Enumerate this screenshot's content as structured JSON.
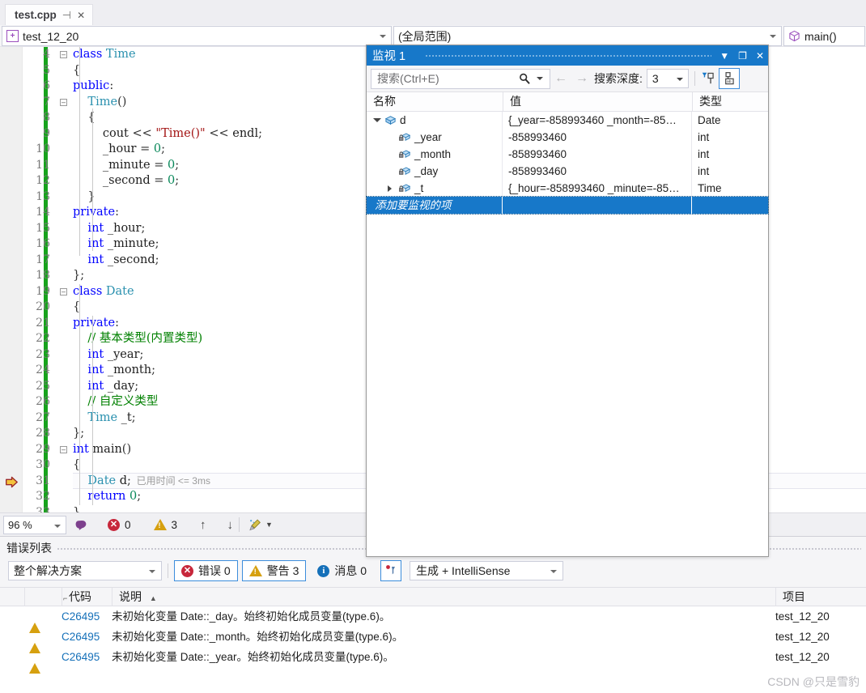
{
  "tabstrip": {
    "document_tab": "test.cpp",
    "pin_icon": "pin-icon",
    "close_icon": "close-icon"
  },
  "navbar": {
    "file_combo": "test_12_20",
    "scope_combo": "(全局范围)",
    "member_combo": "main()"
  },
  "editor": {
    "language": "cpp",
    "lines": [
      {
        "num": "4",
        "indent": 0,
        "fold": "minus",
        "tokens": [
          {
            "t": "class ",
            "c": "kw"
          },
          {
            "t": "Time",
            "c": "typ"
          }
        ]
      },
      {
        "num": "5",
        "indent": 0,
        "tokens": [
          {
            "t": "{",
            "c": "op"
          }
        ]
      },
      {
        "num": "6",
        "indent": 0,
        "tokens": [
          {
            "t": "public",
            "c": "kw"
          },
          {
            "t": ":",
            "c": "op"
          }
        ]
      },
      {
        "num": "7",
        "indent": 1,
        "fold": "minus",
        "tokens": [
          {
            "t": "    Time",
            "c": "typ"
          },
          {
            "t": "()",
            "c": "op"
          }
        ]
      },
      {
        "num": "8",
        "indent": 1,
        "tokens": [
          {
            "t": "    {",
            "c": "op"
          }
        ]
      },
      {
        "num": "9",
        "indent": 2,
        "tokens": [
          {
            "t": "        cout ",
            "c": "plain"
          },
          {
            "t": "<< ",
            "c": "op"
          },
          {
            "t": "\"Time()\"",
            "c": "str"
          },
          {
            "t": " << ",
            "c": "op"
          },
          {
            "t": "endl",
            "c": "plain"
          },
          {
            "t": ";",
            "c": "op"
          }
        ]
      },
      {
        "num": "10",
        "indent": 2,
        "tokens": [
          {
            "t": "        _hour ",
            "c": "plain"
          },
          {
            "t": "= ",
            "c": "op"
          },
          {
            "t": "0",
            "c": "num"
          },
          {
            "t": ";",
            "c": "op"
          }
        ]
      },
      {
        "num": "11",
        "indent": 2,
        "tokens": [
          {
            "t": "        _minute ",
            "c": "plain"
          },
          {
            "t": "= ",
            "c": "op"
          },
          {
            "t": "0",
            "c": "num"
          },
          {
            "t": ";",
            "c": "op"
          }
        ]
      },
      {
        "num": "12",
        "indent": 2,
        "tokens": [
          {
            "t": "        _second ",
            "c": "plain"
          },
          {
            "t": "= ",
            "c": "op"
          },
          {
            "t": "0",
            "c": "num"
          },
          {
            "t": ";",
            "c": "op"
          }
        ]
      },
      {
        "num": "13",
        "indent": 1,
        "tokens": [
          {
            "t": "    }",
            "c": "op"
          }
        ]
      },
      {
        "num": "14",
        "indent": 0,
        "tokens": [
          {
            "t": "private",
            "c": "kw"
          },
          {
            "t": ":",
            "c": "op"
          }
        ]
      },
      {
        "num": "15",
        "indent": 1,
        "tokens": [
          {
            "t": "    int",
            "c": "kw"
          },
          {
            "t": " _hour",
            "c": "plain"
          },
          {
            "t": ";",
            "c": "op"
          }
        ]
      },
      {
        "num": "16",
        "indent": 1,
        "tokens": [
          {
            "t": "    int",
            "c": "kw"
          },
          {
            "t": " _minute",
            "c": "plain"
          },
          {
            "t": ";",
            "c": "op"
          }
        ]
      },
      {
        "num": "17",
        "indent": 1,
        "tokens": [
          {
            "t": "    int",
            "c": "kw"
          },
          {
            "t": " _second",
            "c": "plain"
          },
          {
            "t": ";",
            "c": "op"
          }
        ]
      },
      {
        "num": "18",
        "indent": 0,
        "tokens": [
          {
            "t": "};",
            "c": "op"
          }
        ]
      },
      {
        "num": "19",
        "indent": 0,
        "fold": "minus",
        "tokens": [
          {
            "t": "class ",
            "c": "kw"
          },
          {
            "t": "Date",
            "c": "typ"
          }
        ]
      },
      {
        "num": "20",
        "indent": 0,
        "tokens": [
          {
            "t": "{",
            "c": "op"
          }
        ]
      },
      {
        "num": "21",
        "indent": 0,
        "tokens": [
          {
            "t": "private",
            "c": "kw"
          },
          {
            "t": ":",
            "c": "op"
          }
        ]
      },
      {
        "num": "22",
        "indent": 1,
        "tokens": [
          {
            "t": "    // 基本类型(内置类型)",
            "c": "cmt"
          }
        ]
      },
      {
        "num": "23",
        "indent": 1,
        "tokens": [
          {
            "t": "    int",
            "c": "kw"
          },
          {
            "t": " _year",
            "c": "plain"
          },
          {
            "t": ";",
            "c": "op"
          }
        ]
      },
      {
        "num": "24",
        "indent": 1,
        "tokens": [
          {
            "t": "    int",
            "c": "kw"
          },
          {
            "t": " _month",
            "c": "plain"
          },
          {
            "t": ";",
            "c": "op"
          }
        ]
      },
      {
        "num": "25",
        "indent": 1,
        "tokens": [
          {
            "t": "    int",
            "c": "kw"
          },
          {
            "t": " _day",
            "c": "plain"
          },
          {
            "t": ";",
            "c": "op"
          }
        ]
      },
      {
        "num": "26",
        "indent": 1,
        "tokens": [
          {
            "t": "    // 自定义类型",
            "c": "cmt"
          }
        ]
      },
      {
        "num": "27",
        "indent": 1,
        "tokens": [
          {
            "t": "    Time",
            "c": "typ"
          },
          {
            "t": " _t",
            "c": "plain"
          },
          {
            "t": ";",
            "c": "op"
          }
        ]
      },
      {
        "num": "28",
        "indent": 0,
        "tokens": [
          {
            "t": "};",
            "c": "op"
          }
        ]
      },
      {
        "num": "29",
        "indent": 0,
        "fold": "minus",
        "tokens": [
          {
            "t": "int ",
            "c": "kw"
          },
          {
            "t": "main",
            "c": "plain"
          },
          {
            "t": "()",
            "c": "op"
          }
        ]
      },
      {
        "num": "30",
        "indent": 0,
        "tokens": [
          {
            "t": "{",
            "c": "op"
          }
        ]
      },
      {
        "num": "31",
        "indent": 1,
        "current": true,
        "tokens": [
          {
            "t": "    Date",
            "c": "typ"
          },
          {
            "t": " d",
            "c": "plain"
          },
          {
            "t": ";",
            "c": "op"
          }
        ],
        "hint": "已用时间 <= 3ms"
      },
      {
        "num": "32",
        "indent": 1,
        "tokens": [
          {
            "t": "    return",
            "c": "kw"
          },
          {
            "t": " ",
            "c": "plain"
          },
          {
            "t": "0",
            "c": "num"
          },
          {
            "t": ";",
            "c": "op"
          }
        ]
      },
      {
        "num": "33",
        "indent": 0,
        "tokens": [
          {
            "t": "}",
            "c": "op"
          }
        ]
      }
    ],
    "exec_pointer_line": "31",
    "exec_pointer_icon": "execution-pointer-arrow-icon"
  },
  "editor_status": {
    "zoom": "96 %",
    "intellisense_icon": "intellisense-head-icon",
    "error_count": "0",
    "warning_count": "3",
    "up_arrow": "↑",
    "down_arrow": "↓",
    "broom_icon": "code-cleanup-icon"
  },
  "watch_window": {
    "title": "监视 1",
    "dropdown_icon": "chevron-down-icon",
    "maximize_icon": "maximize-icon",
    "close_icon": "close-icon",
    "search_placeholder": "搜索(Ctrl+E)",
    "search_icon": "search-icon",
    "back_arrow": "←",
    "forward_arrow": "→",
    "depth_label": "搜索深度:",
    "depth_value": "3",
    "pin_icon": "filter-pin-icon",
    "pin_ab_icon": "pin-ab-icon",
    "columns": [
      "名称",
      "值",
      "类型"
    ],
    "rows": [
      {
        "indent": 0,
        "expander": "open",
        "icon": "object-icon",
        "name": "d",
        "value": "{_year=-858993460 _month=-85…",
        "type": "Date"
      },
      {
        "indent": 1,
        "expander": "none",
        "icon": "private-field-icon",
        "name": "_year",
        "value": "-858993460",
        "type": "int"
      },
      {
        "indent": 1,
        "expander": "none",
        "icon": "private-field-icon",
        "name": "_month",
        "value": "-858993460",
        "type": "int"
      },
      {
        "indent": 1,
        "expander": "none",
        "icon": "private-field-icon",
        "name": "_day",
        "value": "-858993460",
        "type": "int"
      },
      {
        "indent": 1,
        "expander": "closed",
        "icon": "private-field-icon",
        "name": "_t",
        "value": "{_hour=-858993460 _minute=-85…",
        "type": "Time"
      }
    ],
    "add_row_placeholder": "添加要监视的项"
  },
  "error_list": {
    "title": "错误列表",
    "scope_filter": "整个解决方案",
    "error_button": "错误 0",
    "warning_button": "警告 3",
    "message_button": "消息 0",
    "filter_icon": "error-filter-icon",
    "build_filter": "生成 + IntelliSense",
    "columns": {
      "icon": "",
      "pin": "",
      "code": "代码",
      "description": "说明",
      "sort_indicator": "▲",
      "project": "项目"
    },
    "rows": [
      {
        "severity": "warning",
        "code": "C26495",
        "description": "未初始化变量 Date::_day。始终初始化成员变量(type.6)。",
        "project": "test_12_20"
      },
      {
        "severity": "warning",
        "code": "C26495",
        "description": "未初始化变量 Date::_month。始终初始化成员变量(type.6)。",
        "project": "test_12_20"
      },
      {
        "severity": "warning",
        "code": "C26495",
        "description": "未初始化变量 Date::_year。始终初始化成员变量(type.6)。",
        "project": "test_12_20"
      }
    ]
  },
  "watermark": "CSDN @只是雪豹",
  "colors": {
    "accent_blue": "#1778c9",
    "warning_amber": "#d6a00f",
    "error_red": "#c7273b",
    "info_blue": "#1570b9",
    "keyword_blue": "#0000ff",
    "type_teal": "#2b91af",
    "string_red": "#a31515",
    "comment_green": "#008000",
    "track_green": "#17a31c"
  }
}
